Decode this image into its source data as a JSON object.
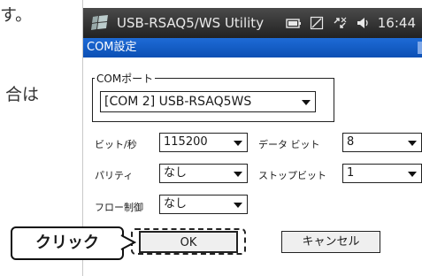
{
  "background": {
    "line1": "す。",
    "line2": "合は"
  },
  "statusbar": {
    "title": "USB-RSAQ5/WS Utility",
    "time": "16:44",
    "icons": [
      "windows-logo-icon",
      "battery-icon",
      "signal-off-icon",
      "connectivity-icon",
      "speaker-icon"
    ]
  },
  "window": {
    "title": "COM設定"
  },
  "com_port": {
    "group_label": "COMポート",
    "selected": "[COM 2] USB-RSAQ5WS"
  },
  "fields": {
    "baud": {
      "label": "ビット/秒",
      "value": "115200"
    },
    "databits": {
      "label": "データ ビット",
      "value": "8"
    },
    "parity": {
      "label": "パリティ",
      "value": "なし"
    },
    "stopbits": {
      "label": "ストップビット",
      "value": "1"
    },
    "flow": {
      "label": "フロー制御",
      "value": "なし"
    }
  },
  "buttons": {
    "ok": "OK",
    "cancel": "キャンセル"
  },
  "callout": {
    "text": "クリック"
  },
  "colors": {
    "titlebar": "#1e6bd6",
    "statusbar": "#2f2f2f"
  }
}
